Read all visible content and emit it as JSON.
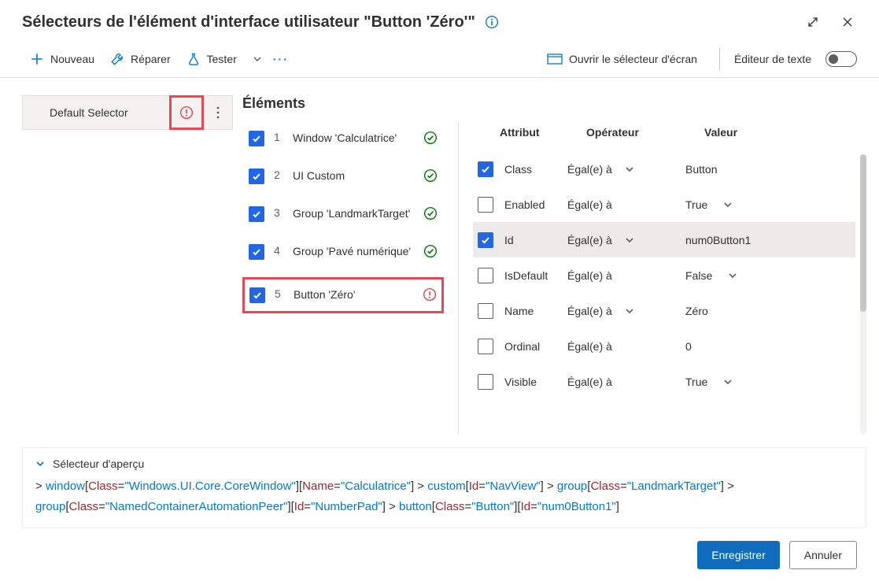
{
  "title": "Sélecteurs de l'élément d'interface utilisateur \"Button 'Zéro'\"",
  "toolbar": {
    "new": "Nouveau",
    "repair": "Réparer",
    "test": "Tester",
    "openScreen": "Ouvrir le sélecteur d'écran",
    "textEditor": "Éditeur de texte"
  },
  "selector": {
    "name": "Default Selector"
  },
  "sectionTitle": "Éléments",
  "elements": [
    {
      "n": "1",
      "label": "Window 'Calculatrice'",
      "status": "ok"
    },
    {
      "n": "2",
      "label": "UI Custom",
      "status": "ok"
    },
    {
      "n": "3",
      "label": "Group 'LandmarkTarget'",
      "status": "ok"
    },
    {
      "n": "4",
      "label": "Group 'Pavé numérique'",
      "status": "ok"
    },
    {
      "n": "5",
      "label": "Button 'Zéro'",
      "status": "err"
    }
  ],
  "attrHeaders": {
    "attr": "Attribut",
    "op": "Opérateur",
    "val": "Valeur"
  },
  "attributes": [
    {
      "checked": true,
      "name": "Class",
      "op": "Égal(e) à",
      "opChev": true,
      "val": "Button",
      "valChev": false
    },
    {
      "checked": false,
      "name": "Enabled",
      "op": "Égal(e) à",
      "opChev": false,
      "val": "True",
      "valChev": true
    },
    {
      "checked": true,
      "name": "Id",
      "op": "Égal(e) à",
      "opChev": true,
      "val": "num0Button1",
      "valChev": false,
      "selected": true
    },
    {
      "checked": false,
      "name": "IsDefault",
      "op": "Égal(e) à",
      "opChev": false,
      "val": "False",
      "valChev": true
    },
    {
      "checked": false,
      "name": "Name",
      "op": "Égal(e) à",
      "opChev": true,
      "val": "Zéro",
      "valChev": false
    },
    {
      "checked": false,
      "name": "Ordinal",
      "op": "Égal(e) à",
      "opChev": false,
      "val": "0",
      "valChev": false
    },
    {
      "checked": false,
      "name": "Visible",
      "op": "Égal(e) à",
      "opChev": false,
      "val": "True",
      "valChev": true
    }
  ],
  "preview": {
    "title": "Sélecteur d'aperçu",
    "tokens": [
      {
        "t": "gt",
        "v": "> "
      },
      {
        "t": "kw",
        "v": "window"
      },
      {
        "t": "br",
        "v": "["
      },
      {
        "t": "prop",
        "v": "Class"
      },
      {
        "t": "eq",
        "v": "="
      },
      {
        "t": "str",
        "v": "\"Windows.UI.Core.CoreWindow\""
      },
      {
        "t": "br",
        "v": "]"
      },
      {
        "t": "br",
        "v": "["
      },
      {
        "t": "prop",
        "v": "Name"
      },
      {
        "t": "eq",
        "v": "="
      },
      {
        "t": "str",
        "v": "\"Calculatrice\""
      },
      {
        "t": "br",
        "v": "]"
      },
      {
        "t": "gt",
        "v": " > "
      },
      {
        "t": "kw",
        "v": "custom"
      },
      {
        "t": "br",
        "v": "["
      },
      {
        "t": "prop",
        "v": "Id"
      },
      {
        "t": "eq",
        "v": "="
      },
      {
        "t": "str",
        "v": "\"NavView\""
      },
      {
        "t": "br",
        "v": "]"
      },
      {
        "t": "gt",
        "v": " > "
      },
      {
        "t": "kw",
        "v": "group"
      },
      {
        "t": "br",
        "v": "["
      },
      {
        "t": "prop",
        "v": "Class"
      },
      {
        "t": "eq",
        "v": "="
      },
      {
        "t": "str",
        "v": "\"LandmarkTarget\""
      },
      {
        "t": "br",
        "v": "]"
      },
      {
        "t": "gt",
        "v": " > "
      },
      {
        "t": "kw",
        "v": "group"
      },
      {
        "t": "br",
        "v": "["
      },
      {
        "t": "prop",
        "v": "Class"
      },
      {
        "t": "eq",
        "v": "="
      },
      {
        "t": "str",
        "v": "\"NamedContainerAutomationPeer\""
      },
      {
        "t": "br",
        "v": "]"
      },
      {
        "t": "br",
        "v": "["
      },
      {
        "t": "prop",
        "v": "Id"
      },
      {
        "t": "eq",
        "v": "="
      },
      {
        "t": "str",
        "v": "\"NumberPad\""
      },
      {
        "t": "br",
        "v": "]"
      },
      {
        "t": "gt",
        "v": " > "
      },
      {
        "t": "kw",
        "v": "button"
      },
      {
        "t": "br",
        "v": "["
      },
      {
        "t": "prop",
        "v": "Class"
      },
      {
        "t": "eq",
        "v": "="
      },
      {
        "t": "str",
        "v": "\"Button\""
      },
      {
        "t": "br",
        "v": "]"
      },
      {
        "t": "br",
        "v": "["
      },
      {
        "t": "prop",
        "v": "Id"
      },
      {
        "t": "eq",
        "v": "="
      },
      {
        "t": "str",
        "v": "\"num0Button1\""
      },
      {
        "t": "br",
        "v": "]"
      }
    ]
  },
  "footer": {
    "save": "Enregistrer",
    "cancel": "Annuler"
  }
}
